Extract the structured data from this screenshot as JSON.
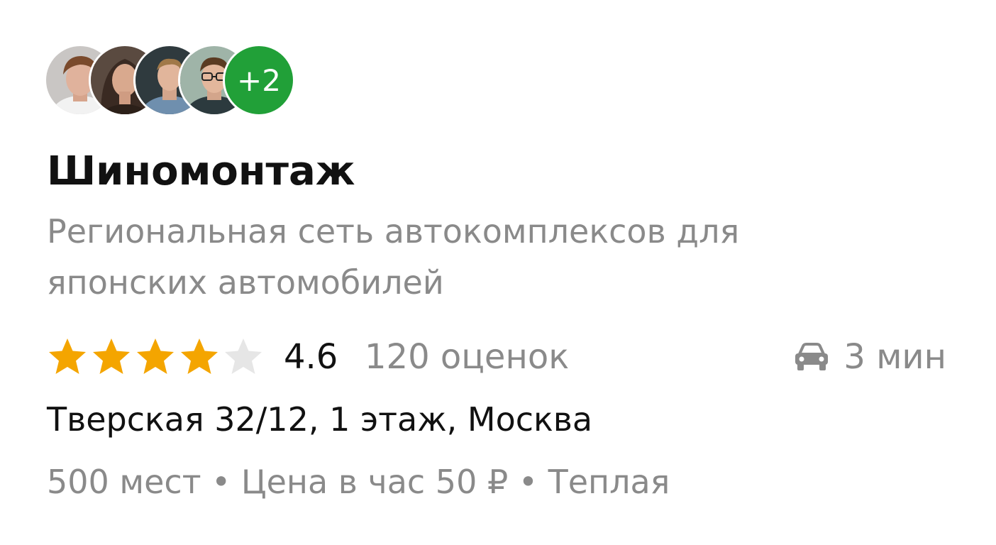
{
  "avatars": {
    "people": [
      {
        "name": "avatar-1"
      },
      {
        "name": "avatar-2"
      },
      {
        "name": "avatar-3"
      },
      {
        "name": "avatar-4"
      }
    ],
    "more_label": "+2",
    "more_color": "#21a038"
  },
  "place": {
    "title": "Шиномонтаж",
    "subtitle": "Региональная сеть автокомплексов для японских автомобилей",
    "rating": {
      "stars_filled": 4,
      "stars_total": 5,
      "value": "4.6",
      "count": "120 оценок",
      "star_color": "#f4a500",
      "star_empty_color": "#e6e6e6"
    },
    "eta": {
      "icon": "car-icon",
      "text": "3 мин"
    },
    "address": "Тверская 32/12, 1 этаж, Москва",
    "meta": "500 мест • Цена в час 50 ₽ • Теплая"
  }
}
